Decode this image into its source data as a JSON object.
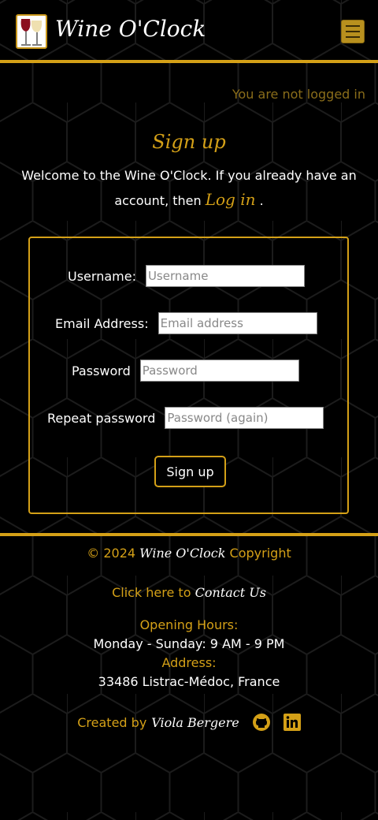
{
  "header": {
    "brand": "Wine O'Clock",
    "menu_icon": "hamburger-icon"
  },
  "status": "You are not logged in",
  "signup": {
    "title": "Sign up",
    "intro_before": "Welcome to the Wine O'Clock. If you already have an account, then ",
    "login_link": "Log in",
    "intro_after": " ."
  },
  "form": {
    "username_label": "Username:",
    "username_placeholder": "Username",
    "email_label": "Email Address:",
    "email_placeholder": "Email address",
    "password_label": "Password",
    "password_placeholder": "Password",
    "password2_label": "Repeat password",
    "password2_placeholder": "Password (again)",
    "submit": "Sign up"
  },
  "footer": {
    "copyright_pre": "© 2024 ",
    "copyright_brand": "Wine O'Clock",
    "copyright_post": " Copyright",
    "contact_pre": "Click here to ",
    "contact_link": "Contact Us",
    "hours_label": "Opening Hours:",
    "hours": "Monday - Sunday: 9 AM - 9 PM",
    "address_label": "Address:",
    "address": "33486 Listrac-Médoc, France",
    "created_pre": "Created by ",
    "author": "Viola Bergere"
  },
  "colors": {
    "accent": "#d4a017"
  }
}
